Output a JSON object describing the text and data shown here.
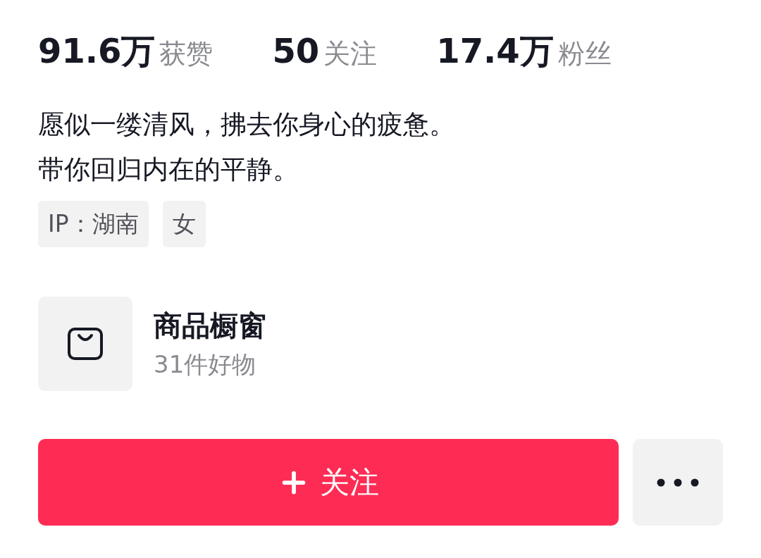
{
  "stats": [
    {
      "value": "91.6万",
      "label": "获赞"
    },
    {
      "value": "50",
      "label": "关注"
    },
    {
      "value": "17.4万",
      "label": "粉丝"
    }
  ],
  "bio": [
    "愿似一缕清风，拂去你身心的疲惫。",
    "带你回归内在的平静。"
  ],
  "tags": [
    "IP：湖南",
    "女"
  ],
  "shop": {
    "title": "商品橱窗",
    "subtitle": "31件好物"
  },
  "follow_button": {
    "label": "关注"
  }
}
